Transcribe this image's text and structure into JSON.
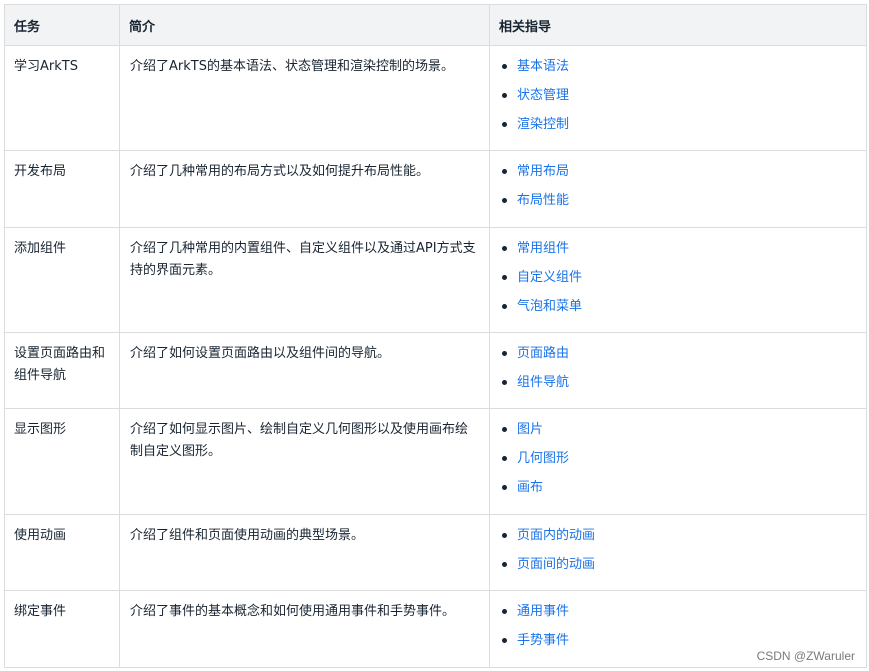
{
  "table": {
    "headers": [
      "任务",
      "简介",
      "相关指导"
    ],
    "rows": [
      {
        "task": "学习ArkTS",
        "desc": "介绍了ArkTS的基本语法、状态管理和渲染控制的场景。",
        "links": [
          "基本语法",
          "状态管理",
          "渲染控制"
        ]
      },
      {
        "task": "开发布局",
        "desc": "介绍了几种常用的布局方式以及如何提升布局性能。",
        "links": [
          "常用布局",
          "布局性能"
        ]
      },
      {
        "task": "添加组件",
        "desc": "介绍了几种常用的内置组件、自定义组件以及通过API方式支持的界面元素。",
        "links": [
          "常用组件",
          "自定义组件",
          "气泡和菜单"
        ]
      },
      {
        "task": "设置页面路由和组件导航",
        "desc": "介绍了如何设置页面路由以及组件间的导航。",
        "links": [
          "页面路由",
          "组件导航"
        ]
      },
      {
        "task": "显示图形",
        "desc": "介绍了如何显示图片、绘制自定义几何图形以及使用画布绘制自定义图形。",
        "links": [
          "图片",
          "几何图形",
          "画布"
        ]
      },
      {
        "task": "使用动画",
        "desc": "介绍了组件和页面使用动画的典型场景。",
        "links": [
          "页面内的动画",
          "页面间的动画"
        ]
      },
      {
        "task": "绑定事件",
        "desc": "介绍了事件的基本概念和如何使用通用事件和手势事件。",
        "links": [
          "通用事件",
          "手势事件"
        ]
      }
    ]
  },
  "watermark": "CSDN @ZWaruler",
  "colors": {
    "link": "#1a73e8",
    "header_bg": "#f1f3f5",
    "border": "#dcdcdc",
    "text": "#182431"
  }
}
